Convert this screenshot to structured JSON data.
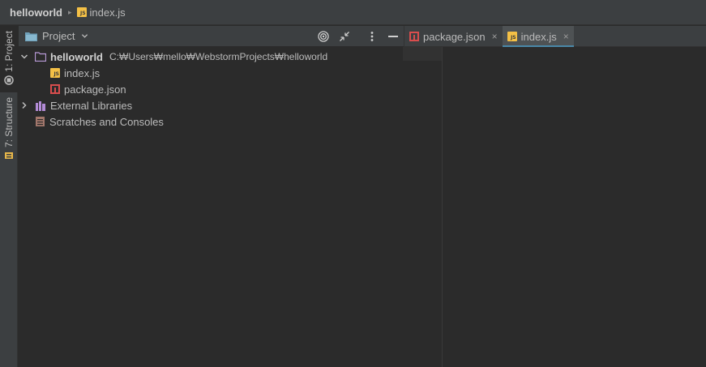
{
  "navbar": {
    "project": "helloworld",
    "file": "index.js"
  },
  "toolstrip": {
    "project_label": "1: Project",
    "structure_label": "7: Structure"
  },
  "panel": {
    "title": "Project"
  },
  "tree": {
    "root_name": "helloworld",
    "root_path": "C:₩Users₩mello₩WebstormProjects₩helloworld",
    "children": [
      "index.js",
      "package.json"
    ],
    "external": "External Libraries",
    "scratches": "Scratches and Consoles"
  },
  "tabs": [
    {
      "label": "package.json",
      "close": "×"
    },
    {
      "label": "index.js",
      "close": "×"
    }
  ],
  "colors": {
    "background": "#2b2b2b",
    "chrome": "#3c3f41",
    "js_icon": "#f4c046",
    "json_icon": "#d84d4d",
    "folder_icon": "#b99bd8",
    "active_tab_underline": "#4a88a8"
  }
}
